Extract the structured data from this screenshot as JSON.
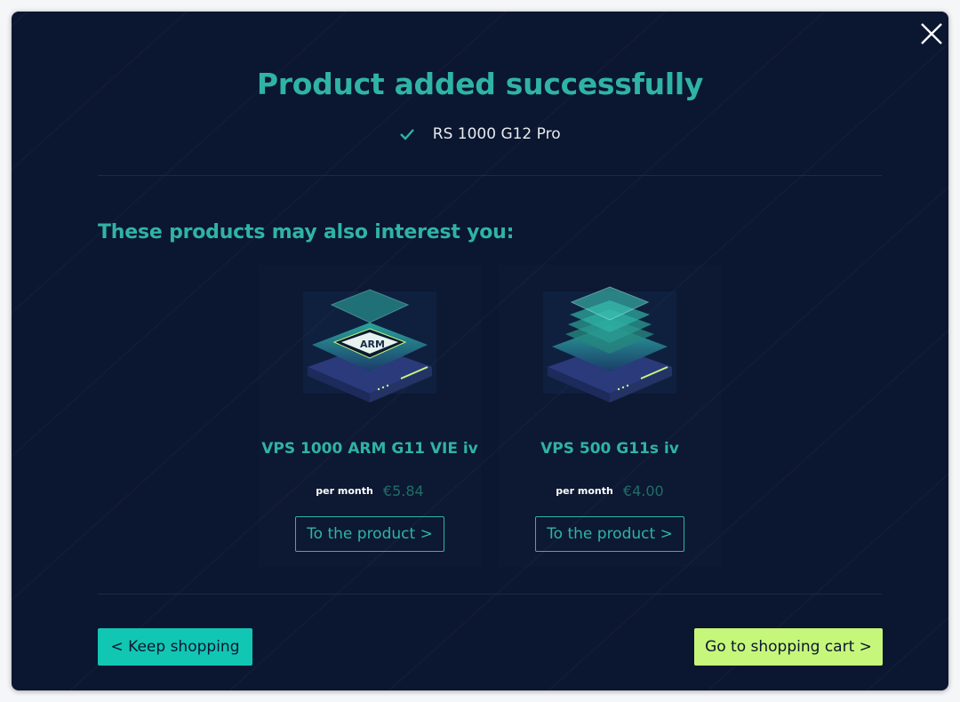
{
  "modal": {
    "title": "Product added successfully",
    "added_product": "RS 1000 G12 Pro",
    "subtitle": "These products may also interest you:"
  },
  "recommendations": [
    {
      "name": "VPS 1000 ARM G11 VIE iv",
      "per_label": "per month",
      "price": "€5.84",
      "button_label": "To the product >",
      "chip_label": "ARM",
      "icon": "arm-server-icon"
    },
    {
      "name": "VPS 500 G11s iv",
      "per_label": "per month",
      "price": "€4.00",
      "button_label": "To the product >",
      "icon": "vps-layers-icon"
    }
  ],
  "footer": {
    "keep_shopping": "< Keep shopping",
    "go_to_cart": "Go to shopping cart >"
  },
  "colors": {
    "background": "#0b1630",
    "accent": "#2fb3a5",
    "keep_button": "#11c7b4",
    "cart_button": "#c6f77a"
  },
  "icons": {
    "close": "close-icon",
    "check": "check-icon"
  }
}
